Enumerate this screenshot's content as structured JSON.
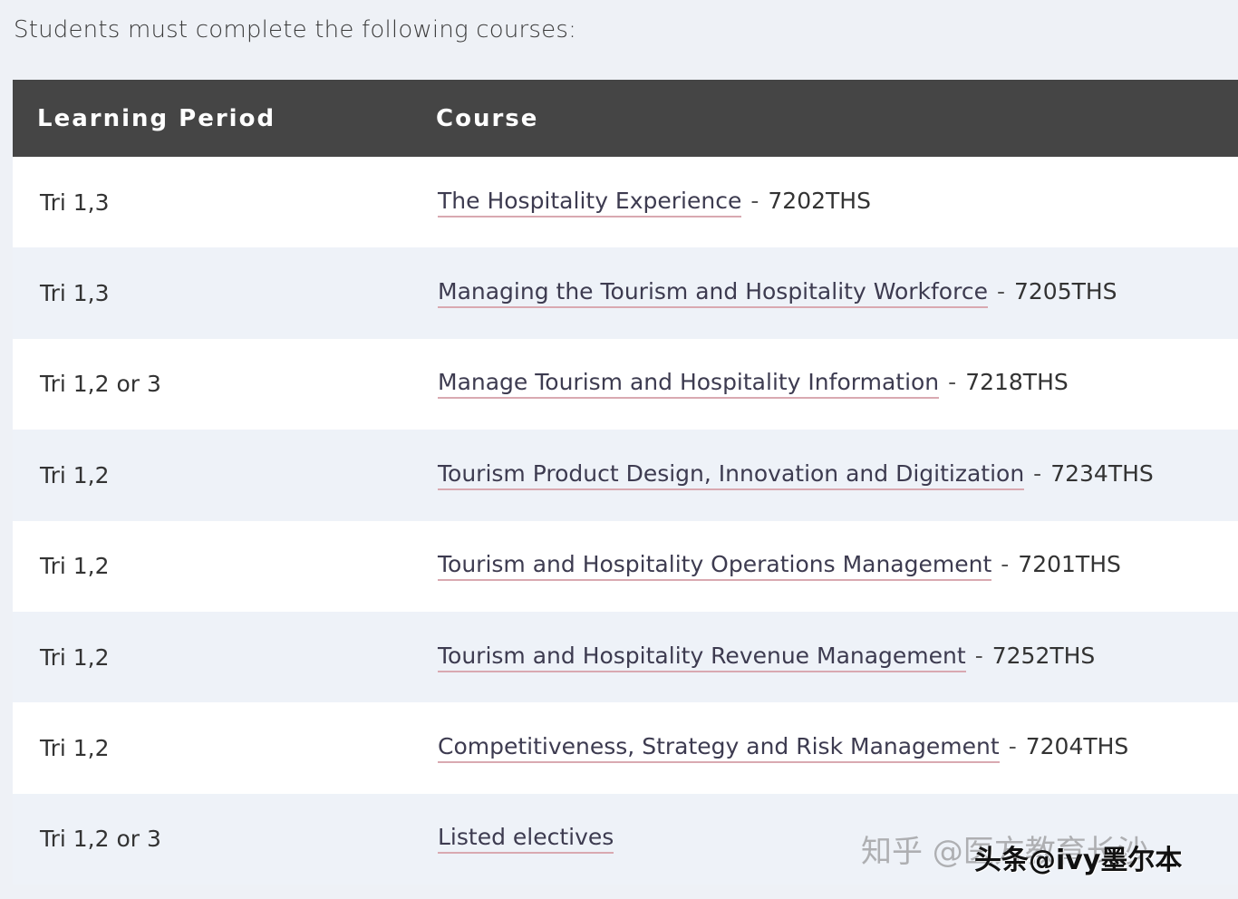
{
  "intro_text": "Students must complete the following courses:",
  "table": {
    "headers": {
      "period": "Learning Period",
      "course": "Course"
    },
    "rows": [
      {
        "period": "Tri 1,3",
        "course": "The Hospitality Experience",
        "separator": "-",
        "code": "7202THS"
      },
      {
        "period": "Tri 1,3",
        "course": "Managing the Tourism and Hospitality Workforce",
        "separator": "-",
        "code": "7205THS"
      },
      {
        "period": "Tri 1,2 or 3",
        "course": "Manage Tourism and Hospitality Information",
        "separator": "-",
        "code": "7218THS"
      },
      {
        "period": "Tri 1,2",
        "course": "Tourism Product Design, Innovation and Digitization",
        "separator": "-",
        "code": "7234THS"
      },
      {
        "period": "Tri 1,2",
        "course": "Tourism and Hospitality Operations Management",
        "separator": "-",
        "code": "7201THS"
      },
      {
        "period": "Tri 1,2",
        "course": "Tourism and Hospitality Revenue Management",
        "separator": "-",
        "code": "7252THS"
      },
      {
        "period": "Tri 1,2",
        "course": "Competitiveness, Strategy and Risk Management",
        "separator": "-",
        "code": "7204THS"
      },
      {
        "period": "Tri 1,2 or 3",
        "course": "Listed electives",
        "separator": "",
        "code": ""
      }
    ]
  },
  "watermarks": {
    "zhihu": "知乎 @医方教育长沙",
    "toutiao": "头条@ivy墨尔本"
  },
  "colors": {
    "header_bg": "#454545",
    "link_underline": "#d9a9b1",
    "page_bg": "#eef1f6"
  }
}
